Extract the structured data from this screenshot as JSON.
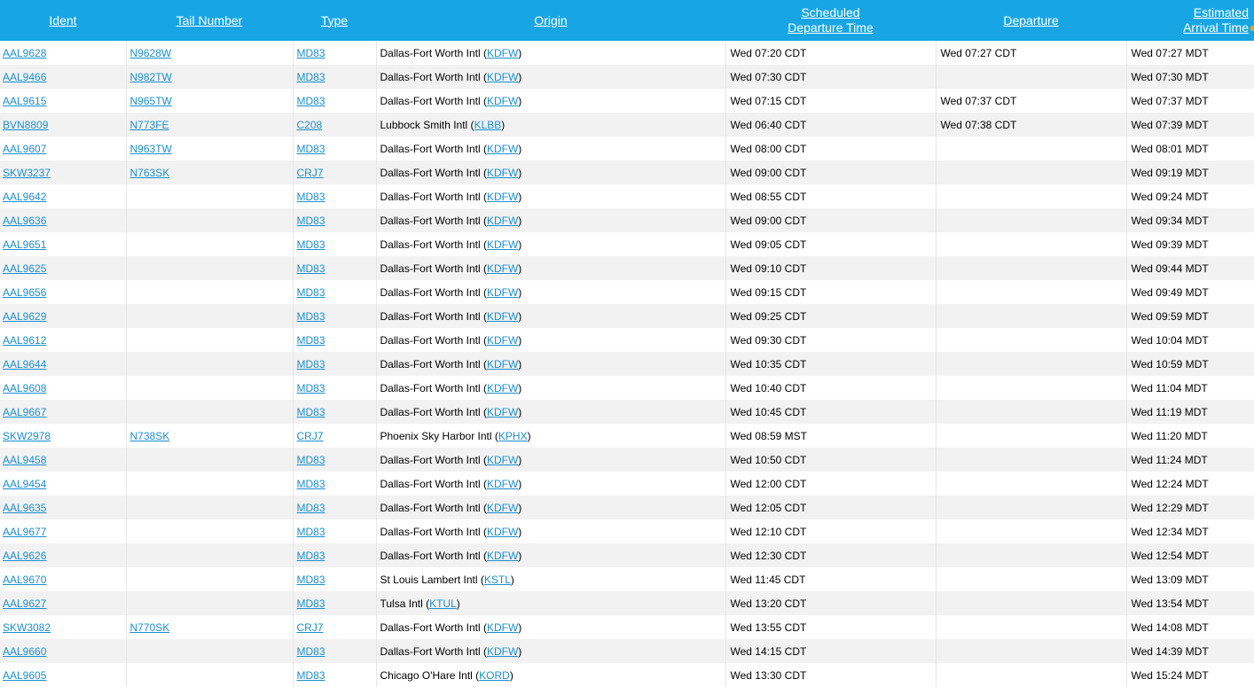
{
  "headers": {
    "ident": "Ident",
    "tail": "Tail Number",
    "type": "Type",
    "origin": "Origin",
    "sched_line1": "Scheduled",
    "sched_line2": "Departure Time",
    "departure": "Departure",
    "arr_line1": "Estimated",
    "arr_line2": "Arrival Time"
  },
  "colors": {
    "header_bg": "#17a6e3",
    "link": "#1a8fd0",
    "row_alt": "#f2f2f2"
  },
  "rows": [
    {
      "ident": "AAL9628",
      "tail": "N9628W",
      "type": "MD83",
      "origin_name": "Dallas-Fort Worth Intl (",
      "origin_code": "KDFW",
      "origin_close": ")",
      "sched": "Wed 07:20 CDT",
      "dep": "Wed 07:27 CDT",
      "arr": "Wed 07:27 MDT"
    },
    {
      "ident": "AAL9466",
      "tail": "N982TW",
      "type": "MD83",
      "origin_name": "Dallas-Fort Worth Intl (",
      "origin_code": "KDFW",
      "origin_close": ")",
      "sched": "Wed 07:30 CDT",
      "dep": "",
      "arr": "Wed 07:30 MDT"
    },
    {
      "ident": "AAL9615",
      "tail": "N965TW",
      "type": "MD83",
      "origin_name": "Dallas-Fort Worth Intl (",
      "origin_code": "KDFW",
      "origin_close": ")",
      "sched": "Wed 07:15 CDT",
      "dep": "Wed 07:37 CDT",
      "arr": "Wed 07:37 MDT"
    },
    {
      "ident": "BVN8809",
      "tail": "N773FE",
      "type": "C208",
      "origin_name": "Lubbock Smith Intl (",
      "origin_code": "KLBB",
      "origin_close": ")",
      "sched": "Wed 06:40 CDT",
      "dep": "Wed 07:38 CDT",
      "arr": "Wed 07:39 MDT"
    },
    {
      "ident": "AAL9607",
      "tail": "N963TW",
      "type": "MD83",
      "origin_name": "Dallas-Fort Worth Intl (",
      "origin_code": "KDFW",
      "origin_close": ")",
      "sched": "Wed 08:00 CDT",
      "dep": "",
      "arr": "Wed 08:01 MDT"
    },
    {
      "ident": "SKW3237",
      "tail": "N763SK",
      "type": "CRJ7",
      "origin_name": "Dallas-Fort Worth Intl (",
      "origin_code": "KDFW",
      "origin_close": ")",
      "sched": "Wed 09:00 CDT",
      "dep": "",
      "arr": "Wed 09:19 MDT"
    },
    {
      "ident": "AAL9642",
      "tail": "",
      "type": "MD83",
      "origin_name": "Dallas-Fort Worth Intl (",
      "origin_code": "KDFW",
      "origin_close": ")",
      "sched": "Wed 08:55 CDT",
      "dep": "",
      "arr": "Wed 09:24 MDT"
    },
    {
      "ident": "AAL9636",
      "tail": "",
      "type": "MD83",
      "origin_name": "Dallas-Fort Worth Intl (",
      "origin_code": "KDFW",
      "origin_close": ")",
      "sched": "Wed 09:00 CDT",
      "dep": "",
      "arr": "Wed 09:34 MDT"
    },
    {
      "ident": "AAL9651",
      "tail": "",
      "type": "MD83",
      "origin_name": "Dallas-Fort Worth Intl (",
      "origin_code": "KDFW",
      "origin_close": ")",
      "sched": "Wed 09:05 CDT",
      "dep": "",
      "arr": "Wed 09:39 MDT"
    },
    {
      "ident": "AAL9625",
      "tail": "",
      "type": "MD83",
      "origin_name": "Dallas-Fort Worth Intl (",
      "origin_code": "KDFW",
      "origin_close": ")",
      "sched": "Wed 09:10 CDT",
      "dep": "",
      "arr": "Wed 09:44 MDT"
    },
    {
      "ident": "AAL9656",
      "tail": "",
      "type": "MD83",
      "origin_name": "Dallas-Fort Worth Intl (",
      "origin_code": "KDFW",
      "origin_close": ")",
      "sched": "Wed 09:15 CDT",
      "dep": "",
      "arr": "Wed 09:49 MDT"
    },
    {
      "ident": "AAL9629",
      "tail": "",
      "type": "MD83",
      "origin_name": "Dallas-Fort Worth Intl (",
      "origin_code": "KDFW",
      "origin_close": ")",
      "sched": "Wed 09:25 CDT",
      "dep": "",
      "arr": "Wed 09:59 MDT"
    },
    {
      "ident": "AAL9612",
      "tail": "",
      "type": "MD83",
      "origin_name": "Dallas-Fort Worth Intl (",
      "origin_code": "KDFW",
      "origin_close": ")",
      "sched": "Wed 09:30 CDT",
      "dep": "",
      "arr": "Wed 10:04 MDT"
    },
    {
      "ident": "AAL9644",
      "tail": "",
      "type": "MD83",
      "origin_name": "Dallas-Fort Worth Intl (",
      "origin_code": "KDFW",
      "origin_close": ")",
      "sched": "Wed 10:35 CDT",
      "dep": "",
      "arr": "Wed 10:59 MDT"
    },
    {
      "ident": "AAL9608",
      "tail": "",
      "type": "MD83",
      "origin_name": "Dallas-Fort Worth Intl (",
      "origin_code": "KDFW",
      "origin_close": ")",
      "sched": "Wed 10:40 CDT",
      "dep": "",
      "arr": "Wed 11:04 MDT"
    },
    {
      "ident": "AAL9667",
      "tail": "",
      "type": "MD83",
      "origin_name": "Dallas-Fort Worth Intl (",
      "origin_code": "KDFW",
      "origin_close": ")",
      "sched": "Wed 10:45 CDT",
      "dep": "",
      "arr": "Wed 11:19 MDT"
    },
    {
      "ident": "SKW2978",
      "tail": "N738SK",
      "type": "CRJ7",
      "origin_name": "Phoenix Sky Harbor Intl (",
      "origin_code": "KPHX",
      "origin_close": ")",
      "sched": "Wed 08:59 MST",
      "dep": "",
      "arr": "Wed 11:20 MDT"
    },
    {
      "ident": "AAL9458",
      "tail": "",
      "type": "MD83",
      "origin_name": "Dallas-Fort Worth Intl (",
      "origin_code": "KDFW",
      "origin_close": ")",
      "sched": "Wed 10:50 CDT",
      "dep": "",
      "arr": "Wed 11:24 MDT"
    },
    {
      "ident": "AAL9454",
      "tail": "",
      "type": "MD83",
      "origin_name": "Dallas-Fort Worth Intl (",
      "origin_code": "KDFW",
      "origin_close": ")",
      "sched": "Wed 12:00 CDT",
      "dep": "",
      "arr": "Wed 12:24 MDT"
    },
    {
      "ident": "AAL9635",
      "tail": "",
      "type": "MD83",
      "origin_name": "Dallas-Fort Worth Intl (",
      "origin_code": "KDFW",
      "origin_close": ")",
      "sched": "Wed 12:05 CDT",
      "dep": "",
      "arr": "Wed 12:29 MDT"
    },
    {
      "ident": "AAL9677",
      "tail": "",
      "type": "MD83",
      "origin_name": "Dallas-Fort Worth Intl (",
      "origin_code": "KDFW",
      "origin_close": ")",
      "sched": "Wed 12:10 CDT",
      "dep": "",
      "arr": "Wed 12:34 MDT"
    },
    {
      "ident": "AAL9626",
      "tail": "",
      "type": "MD83",
      "origin_name": "Dallas-Fort Worth Intl (",
      "origin_code": "KDFW",
      "origin_close": ")",
      "sched": "Wed 12:30 CDT",
      "dep": "",
      "arr": "Wed 12:54 MDT"
    },
    {
      "ident": "AAL9670",
      "tail": "",
      "type": "MD83",
      "origin_name": "St Louis Lambert Intl (",
      "origin_code": "KSTL",
      "origin_close": ")",
      "sched": "Wed 11:45 CDT",
      "dep": "",
      "arr": "Wed 13:09 MDT"
    },
    {
      "ident": "AAL9627",
      "tail": "",
      "type": "MD83",
      "origin_name": "Tulsa Intl (",
      "origin_code": "KTUL",
      "origin_close": ")",
      "sched": "Wed 13:20 CDT",
      "dep": "",
      "arr": "Wed 13:54 MDT"
    },
    {
      "ident": "SKW3082",
      "tail": "N770SK",
      "type": "CRJ7",
      "origin_name": "Dallas-Fort Worth Intl (",
      "origin_code": "KDFW",
      "origin_close": ")",
      "sched": "Wed 13:55 CDT",
      "dep": "",
      "arr": "Wed 14:08 MDT"
    },
    {
      "ident": "AAL9660",
      "tail": "",
      "type": "MD83",
      "origin_name": "Dallas-Fort Worth Intl (",
      "origin_code": "KDFW",
      "origin_close": ")",
      "sched": "Wed 14:15 CDT",
      "dep": "",
      "arr": "Wed 14:39 MDT"
    },
    {
      "ident": "AAL9605",
      "tail": "",
      "type": "MD83",
      "origin_name": "Chicago O'Hare Intl (",
      "origin_code": "KORD",
      "origin_close": ")",
      "sched": "Wed 13:30 CDT",
      "dep": "",
      "arr": "Wed 15:24 MDT"
    }
  ]
}
